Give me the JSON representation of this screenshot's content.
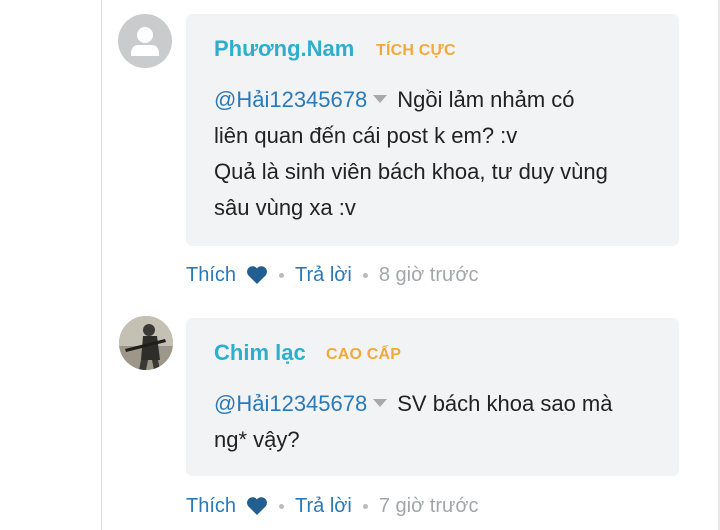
{
  "comments": [
    {
      "username": "Phương.Nam",
      "rank": "TÍCH CỰC",
      "mention": "@Hải12345678",
      "text_first": "Ngồi lảm nhảm có",
      "text_rest": "liên quan đến cái post k em? :v",
      "text_line3": "Quả là sinh viên bách khoa, tư duy vùng",
      "text_line4": "sâu vùng xa :v",
      "like_label": "Thích",
      "reply_label": "Trả lời",
      "time": "8 giờ trước",
      "avatar_icon": "default-user-icon"
    },
    {
      "username": "Chim lạc",
      "rank": "CAO CẤP",
      "mention": "@Hải12345678",
      "text_first": "SV bách khoa sao mà",
      "text_rest": "ng* vậy?",
      "like_label": "Thích",
      "reply_label": "Trả lời",
      "time": "7 giờ trước",
      "avatar_icon": "soldier-photo-avatar"
    }
  ],
  "colors": {
    "username": "#2eaecd",
    "rank": "#f2a93b",
    "link": "#2a79b8",
    "muted": "#a3a6a9",
    "bubble_bg": "#f2f3f4"
  }
}
